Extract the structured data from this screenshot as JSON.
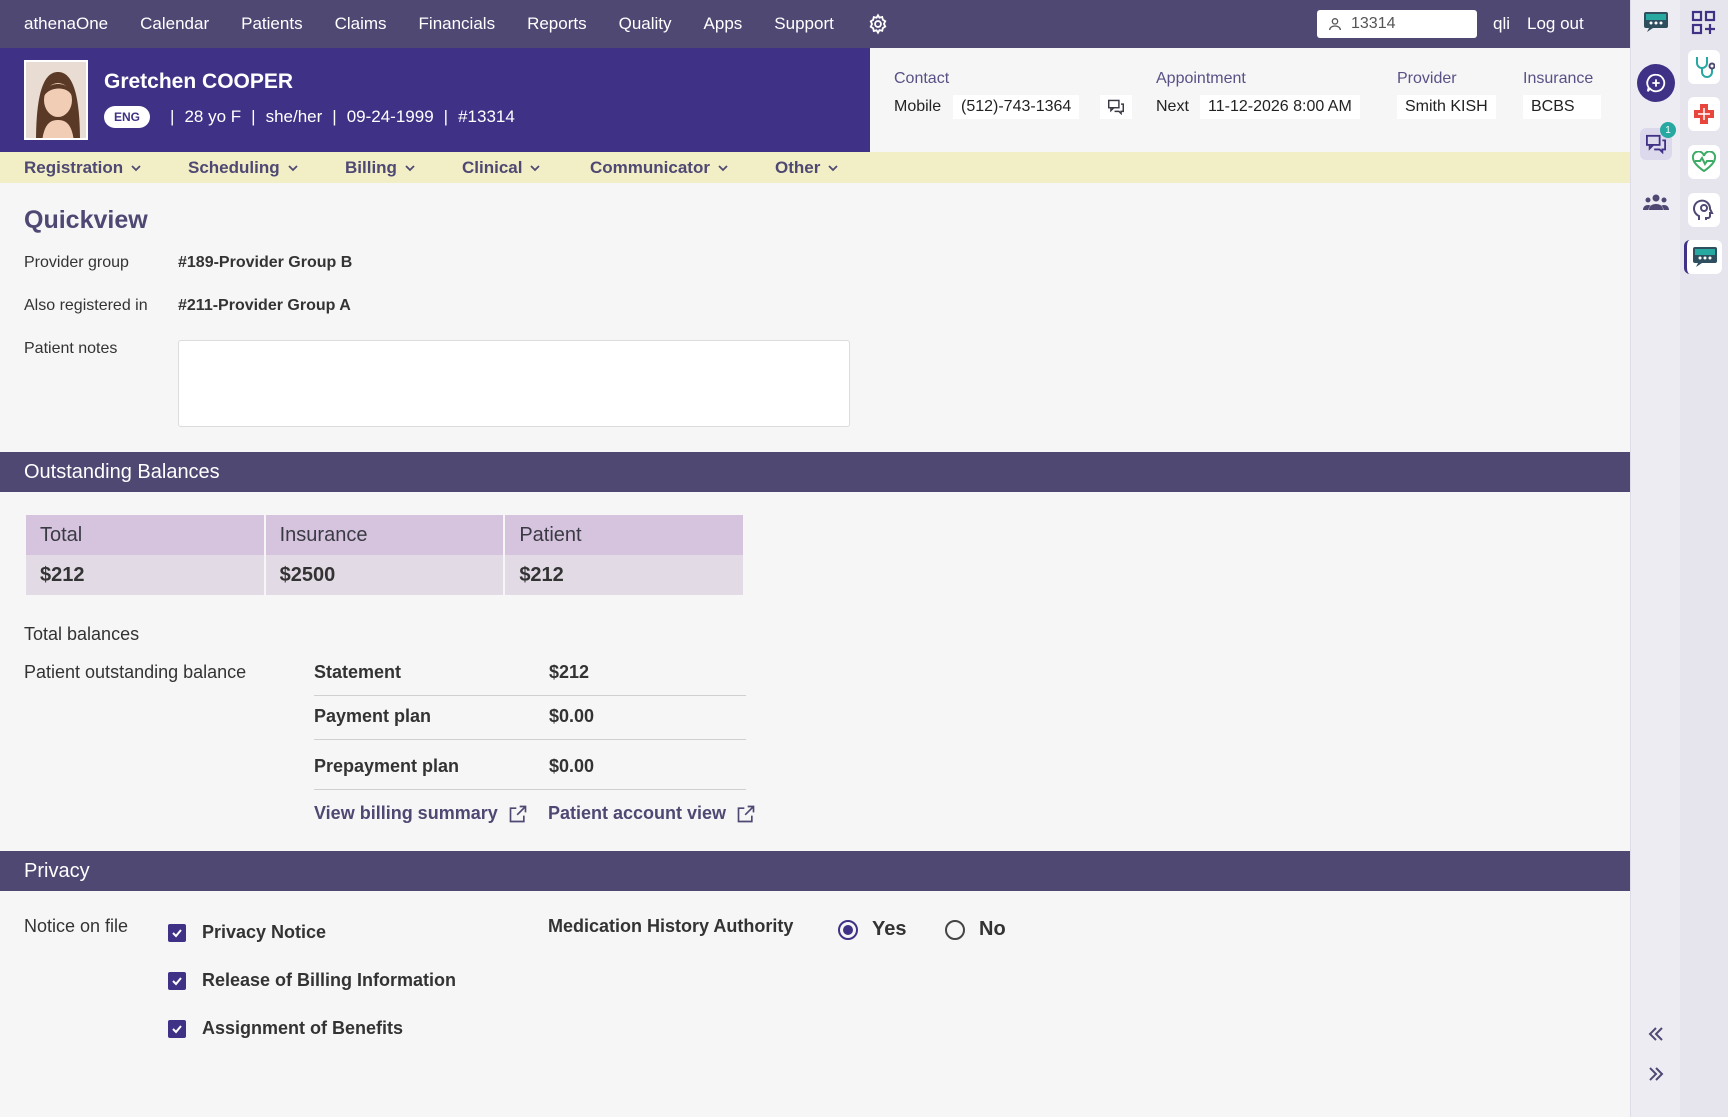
{
  "topnav": {
    "items": [
      "athenaOne",
      "Calendar",
      "Patients",
      "Claims",
      "Financials",
      "Reports",
      "Quality",
      "Apps",
      "Support"
    ],
    "search_value": "13314",
    "user": "qli",
    "logout": "Log out"
  },
  "patient": {
    "name": "Gretchen COOPER",
    "language": "ENG",
    "age_sex": "28 yo F",
    "pronouns": "she/her",
    "dob": "09-24-1999",
    "id": "#13314",
    "sep": "|"
  },
  "contact": {
    "contact_label": "Contact",
    "mobile_label": "Mobile",
    "phone": "(512)-743-1364",
    "appointment_label": "Appointment",
    "next_label": "Next",
    "next_appt": "11-12-2026 8:00 AM",
    "provider_label": "Provider",
    "provider": "Smith KISH",
    "insurance_label": "Insurance",
    "insurance": "BCBS"
  },
  "submenu": [
    "Registration",
    "Scheduling",
    "Billing",
    "Clinical",
    "Communicator",
    "Other"
  ],
  "quickview": {
    "title": "Quickview",
    "provider_group_label": "Provider group",
    "provider_group": "#189-Provider Group B",
    "also_registered_label": "Also registered in",
    "also_registered": "#211-Provider Group A",
    "patient_notes_label": "Patient notes",
    "patient_notes": ""
  },
  "balances": {
    "title": "Outstanding Balances",
    "headers": [
      "Total",
      "Insurance",
      "Patient"
    ],
    "values": [
      "$212",
      "$2500",
      "$212"
    ],
    "total_balances_label": "Total balances",
    "patient_outstanding_label": "Patient outstanding balance",
    "rows": [
      {
        "label": "Statement",
        "value": "$212"
      },
      {
        "label": "Payment plan",
        "value": "$0.00"
      },
      {
        "label": "Prepayment plan",
        "value": "$0.00"
      }
    ],
    "view_billing_summary": "View billing summary",
    "patient_account_view": "Patient account view"
  },
  "privacy": {
    "title": "Privacy",
    "notice_label": "Notice on file",
    "notices": [
      "Privacy Notice",
      "Release of Billing Information",
      "Assignment of Benefits"
    ],
    "med_history_label": "Medication History Authority",
    "yes": "Yes",
    "no": "No",
    "selected": "Yes"
  },
  "rail": {
    "chat_badge": "1"
  },
  "colors": {
    "nav_bg": "#4e4873",
    "banner_bg": "#3f3286",
    "submenu_bg": "#f2efc7",
    "table_header": "#d6c4de",
    "table_cell": "#e2dbe6",
    "accent_teal": "#27a8a0"
  }
}
